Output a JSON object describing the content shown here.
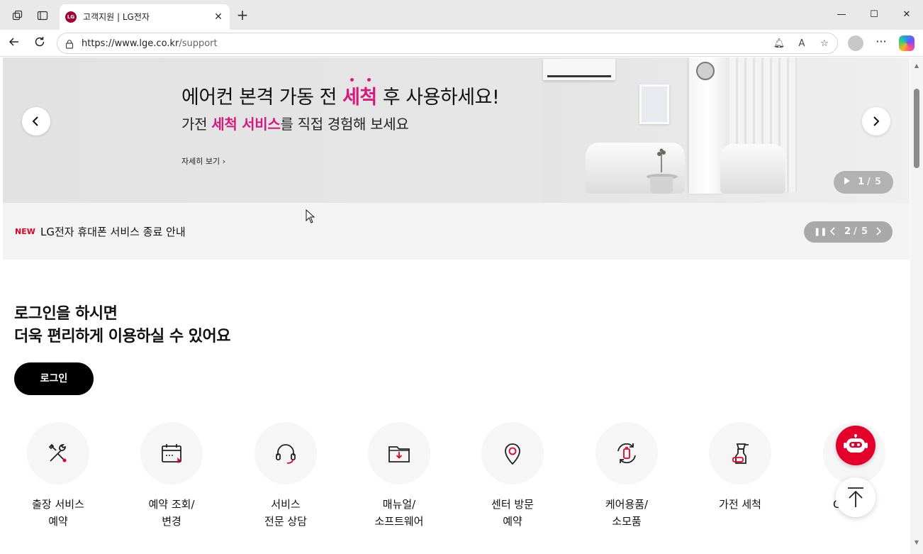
{
  "browser": {
    "tab_title": "고객지원 | LG전자",
    "tab_favicon_text": "LG",
    "url_host": "https://www.lge.co.kr",
    "url_path": "/support",
    "icons": [
      "workspaces-icon",
      "tab-actions-icon",
      "back-icon",
      "reload-icon",
      "lock-icon",
      "notification-icon",
      "read-aloud-icon",
      "favorite-star-icon",
      "profile-icon",
      "more-icon",
      "copilot-icon",
      "minimize-icon",
      "maximize-icon",
      "close-icon"
    ]
  },
  "hero": {
    "title_pre": "에어컨 본격 가동 전 ",
    "title_highlight": "세척",
    "title_post": " 후 사용하세요!",
    "sub_pre": "가전 ",
    "sub_highlight": "세척 서비스",
    "sub_post": "를 직접 경험해 보세요",
    "more_link": "자세히 보기",
    "pager_current": "1",
    "pager_sep": "/",
    "pager_total": "5",
    "highlight_color": "#d6197d"
  },
  "notice": {
    "badge": "NEW",
    "text": "LG전자 휴대폰 서비스 종료 안내",
    "pager_current": "2",
    "pager_sep": "/",
    "pager_total": "5",
    "badge_color": "#e4002b"
  },
  "login": {
    "title_line1": "로그인을 하시면",
    "title_line2": "더욱 편리하게 이용하실 수 있어요",
    "button": "로그인"
  },
  "quick_menu": [
    {
      "line1": "출장 서비스",
      "line2": "예약",
      "icon": "repair-tools-icon"
    },
    {
      "line1": "예약 조회/",
      "line2": "변경",
      "icon": "calendar-check-icon"
    },
    {
      "line1": "서비스",
      "line2": "전문 상담",
      "icon": "headset-icon"
    },
    {
      "line1": "매뉴얼/",
      "line2": "소프트웨어",
      "icon": "folder-download-icon"
    },
    {
      "line1": "센터 방문",
      "line2": "예약",
      "icon": "location-pin-icon"
    },
    {
      "line1": "케어용품/",
      "line2": "소모품",
      "icon": "care-supplies-icon"
    },
    {
      "line1": "가전 세척",
      "line2": "",
      "icon": "spray-cleaning-icon"
    },
    {
      "line1": "C",
      "line2": "",
      "icon": "partially-hidden-icon"
    }
  ],
  "floating": {
    "chatbot": "chatbot-icon",
    "scroll_top": "arrow-up-icon",
    "accent": "#e4002b"
  }
}
